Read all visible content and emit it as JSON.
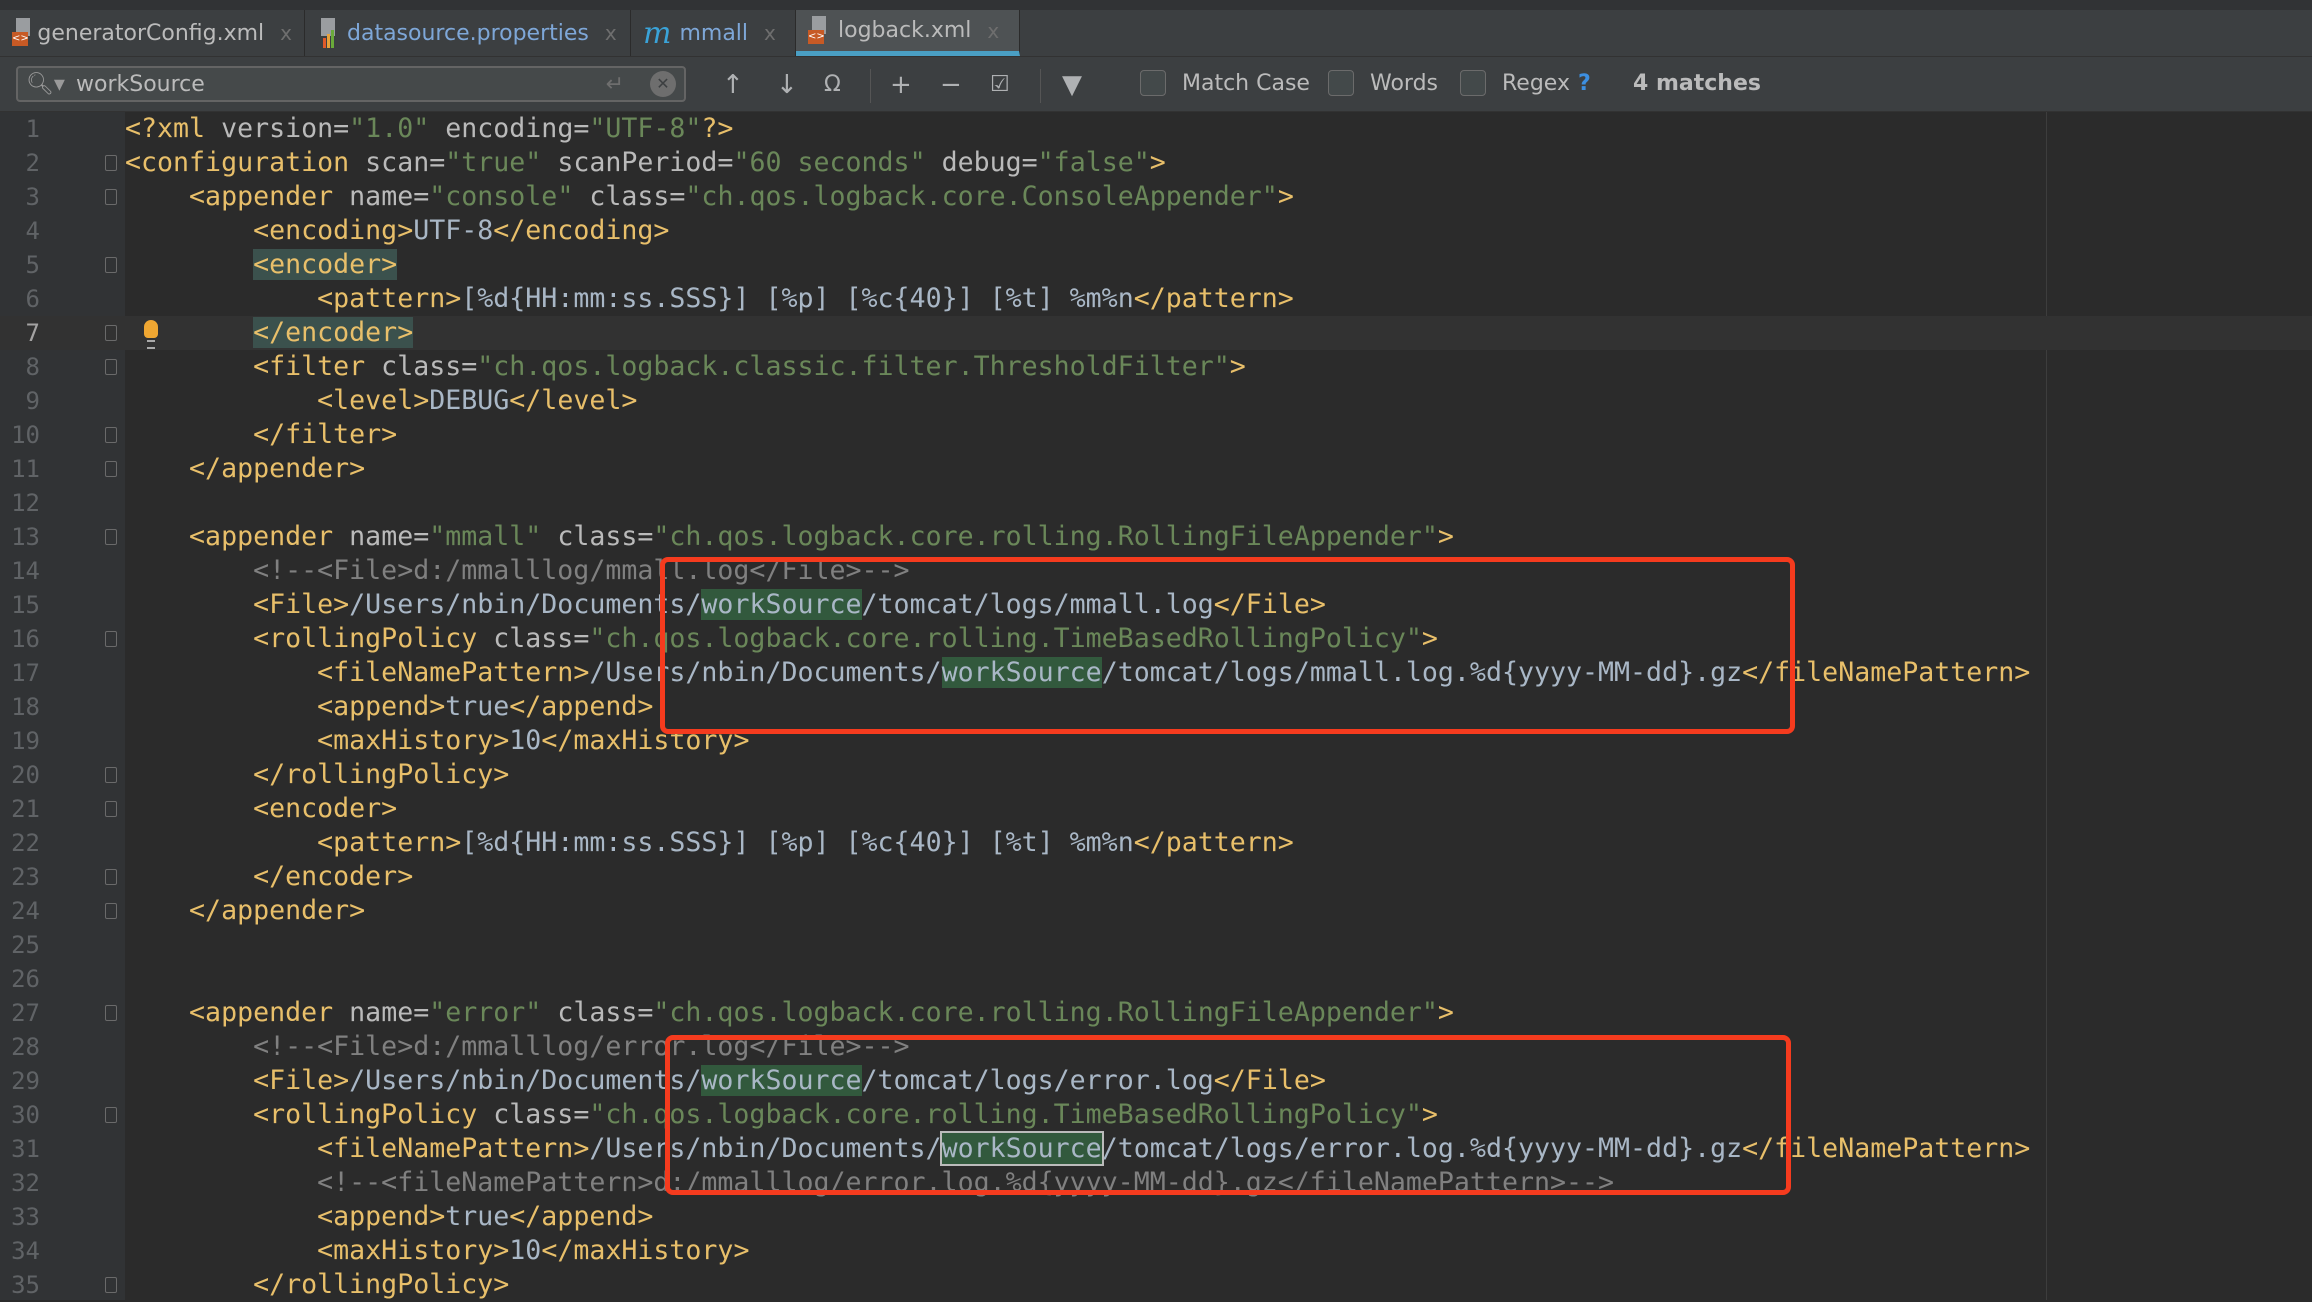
{
  "tabs": [
    {
      "label": "generatorConfig.xml",
      "icon": "xml-file-icon",
      "active": false
    },
    {
      "label": "datasource.properties",
      "icon": "properties-file-icon",
      "active": false
    },
    {
      "label": "mmall",
      "icon": "maven-icon",
      "active": false
    },
    {
      "label": "logback.xml",
      "icon": "xml-file-icon",
      "active": true
    }
  ],
  "tab_close": "x",
  "find": {
    "query": "workSource",
    "options": {
      "match_case": "Match Case",
      "words": "Words",
      "regex": "Regex"
    },
    "help": "?",
    "match_count": "4 matches"
  },
  "colors": {
    "tag": "#e8bf6a",
    "attr": "#bababa",
    "value": "#6a8759",
    "text": "#a9b7c6",
    "comment": "#808080",
    "match_highlight": "#32593d",
    "annotation_box": "#f53b1e",
    "active_tab": "#4a9fc4"
  },
  "editor": {
    "current_line": 7,
    "lines": [
      [
        [
          "t",
          "<?xml"
        ],
        [
          "a",
          " version="
        ],
        [
          "v",
          "\"1.0\""
        ],
        [
          "a",
          " encoding="
        ],
        [
          "v",
          "\"UTF-8\""
        ],
        [
          "t",
          "?>"
        ]
      ],
      [
        [
          "t",
          "<configuration"
        ],
        [
          "a",
          " scan="
        ],
        [
          "v",
          "\"true\""
        ],
        [
          "a",
          " scanPeriod="
        ],
        [
          "v",
          "\"60 seconds\""
        ],
        [
          "a",
          " debug="
        ],
        [
          "v",
          "\"false\""
        ],
        [
          "t",
          ">"
        ]
      ],
      [
        [
          "x",
          "    "
        ],
        [
          "t",
          "<appender"
        ],
        [
          "a",
          " name="
        ],
        [
          "v",
          "\"console\""
        ],
        [
          "a",
          " class="
        ],
        [
          "v",
          "\"ch.qos.logback.core.ConsoleAppender\""
        ],
        [
          "t",
          ">"
        ]
      ],
      [
        [
          "x",
          "        "
        ],
        [
          "t",
          "<encoding>"
        ],
        [
          "x",
          "UTF-8"
        ],
        [
          "t",
          "</encoding>"
        ]
      ],
      [
        [
          "x",
          "        "
        ],
        [
          "m",
          "<encoder>"
        ]
      ],
      [
        [
          "x",
          "            "
        ],
        [
          "t",
          "<pattern>"
        ],
        [
          "x",
          "[%d{HH:mm:ss.SSS}] [%p] [%c{40}] [%t] %m%n"
        ],
        [
          "t",
          "</pattern>"
        ]
      ],
      [
        [
          "x",
          "        "
        ],
        [
          "m",
          "</encoder>"
        ]
      ],
      [
        [
          "x",
          "        "
        ],
        [
          "t",
          "<filter"
        ],
        [
          "a",
          " class="
        ],
        [
          "v",
          "\"ch.qos.logback.classic.filter.ThresholdFilter\""
        ],
        [
          "t",
          ">"
        ]
      ],
      [
        [
          "x",
          "            "
        ],
        [
          "t",
          "<level>"
        ],
        [
          "x",
          "DEBUG"
        ],
        [
          "t",
          "</level>"
        ]
      ],
      [
        [
          "x",
          "        "
        ],
        [
          "t",
          "</filter>"
        ]
      ],
      [
        [
          "x",
          "    "
        ],
        [
          "t",
          "</appender>"
        ]
      ],
      [],
      [
        [
          "x",
          "    "
        ],
        [
          "t",
          "<appender"
        ],
        [
          "a",
          " name="
        ],
        [
          "v",
          "\"mmall\""
        ],
        [
          "a",
          " class="
        ],
        [
          "v",
          "\"ch.qos.logback.core.rolling.RollingFileAppender\""
        ],
        [
          "t",
          ">"
        ]
      ],
      [
        [
          "x",
          "        "
        ],
        [
          "c",
          "<!--<File>d:/mmalllog/mmall.log</File>-->"
        ]
      ],
      [
        [
          "x",
          "        "
        ],
        [
          "t",
          "<File>"
        ],
        [
          "x",
          "/Users/nbin/Documents/"
        ],
        [
          "h",
          "workSource"
        ],
        [
          "x",
          "/tomcat/logs/mmall.log"
        ],
        [
          "t",
          "</File>"
        ]
      ],
      [
        [
          "x",
          "        "
        ],
        [
          "t",
          "<rollingPolicy"
        ],
        [
          "a",
          " class="
        ],
        [
          "v",
          "\"ch.qos.logback.core.rolling.TimeBasedRollingPolicy\""
        ],
        [
          "t",
          ">"
        ]
      ],
      [
        [
          "x",
          "            "
        ],
        [
          "t",
          "<fileNamePattern>"
        ],
        [
          "x",
          "/Users/nbin/Documents/"
        ],
        [
          "h",
          "workSource"
        ],
        [
          "x",
          "/tomcat/logs/mmall.log.%d{yyyy-MM-dd}.gz"
        ],
        [
          "t",
          "</fileNamePattern>"
        ]
      ],
      [
        [
          "x",
          "            "
        ],
        [
          "t",
          "<append>"
        ],
        [
          "x",
          "true"
        ],
        [
          "t",
          "</append>"
        ]
      ],
      [
        [
          "x",
          "            "
        ],
        [
          "t",
          "<maxHistory>"
        ],
        [
          "x",
          "10"
        ],
        [
          "t",
          "</maxHistory>"
        ]
      ],
      [
        [
          "x",
          "        "
        ],
        [
          "t",
          "</rollingPolicy>"
        ]
      ],
      [
        [
          "x",
          "        "
        ],
        [
          "t",
          "<encoder>"
        ]
      ],
      [
        [
          "x",
          "            "
        ],
        [
          "t",
          "<pattern>"
        ],
        [
          "x",
          "[%d{HH:mm:ss.SSS}] [%p] [%c{40}] [%t] %m%n"
        ],
        [
          "t",
          "</pattern>"
        ]
      ],
      [
        [
          "x",
          "        "
        ],
        [
          "t",
          "</encoder>"
        ]
      ],
      [
        [
          "x",
          "    "
        ],
        [
          "t",
          "</appender>"
        ]
      ],
      [],
      [],
      [
        [
          "x",
          "    "
        ],
        [
          "t",
          "<appender"
        ],
        [
          "a",
          " name="
        ],
        [
          "v",
          "\"error\""
        ],
        [
          "a",
          " class="
        ],
        [
          "v",
          "\"ch.qos.logback.core.rolling.RollingFileAppender\""
        ],
        [
          "t",
          ">"
        ]
      ],
      [
        [
          "x",
          "        "
        ],
        [
          "c",
          "<!--<File>d:/mmalllog/error.log</File>-->"
        ]
      ],
      [
        [
          "x",
          "        "
        ],
        [
          "t",
          "<File>"
        ],
        [
          "x",
          "/Users/nbin/Documents/"
        ],
        [
          "h",
          "workSource"
        ],
        [
          "x",
          "/tomcat/logs/error.log"
        ],
        [
          "t",
          "</File>"
        ]
      ],
      [
        [
          "x",
          "        "
        ],
        [
          "t",
          "<rollingPolicy"
        ],
        [
          "a",
          " class="
        ],
        [
          "v",
          "\"ch.qos.logback.core.rolling.TimeBasedRollingPolicy\""
        ],
        [
          "t",
          ">"
        ]
      ],
      [
        [
          "x",
          "            "
        ],
        [
          "t",
          "<fileNamePattern>"
        ],
        [
          "x",
          "/Users/nbin/Documents/"
        ],
        [
          "hs",
          "workSource"
        ],
        [
          "x",
          "/tomcat/logs/error.log.%d{yyyy-MM-dd}.gz"
        ],
        [
          "t",
          "</fileNamePattern>"
        ]
      ],
      [
        [
          "x",
          "            "
        ],
        [
          "c",
          "<!--<fileNamePattern>d:/mmalllog/error.log.%d{yyyy-MM-dd}.gz</fileNamePattern>-->"
        ]
      ],
      [
        [
          "x",
          "            "
        ],
        [
          "t",
          "<append>"
        ],
        [
          "x",
          "true"
        ],
        [
          "t",
          "</append>"
        ]
      ],
      [
        [
          "x",
          "            "
        ],
        [
          "t",
          "<maxHistory>"
        ],
        [
          "x",
          "10"
        ],
        [
          "t",
          "</maxHistory>"
        ]
      ],
      [
        [
          "x",
          "        "
        ],
        [
          "t",
          "</rollingPolicy>"
        ]
      ]
    ]
  }
}
